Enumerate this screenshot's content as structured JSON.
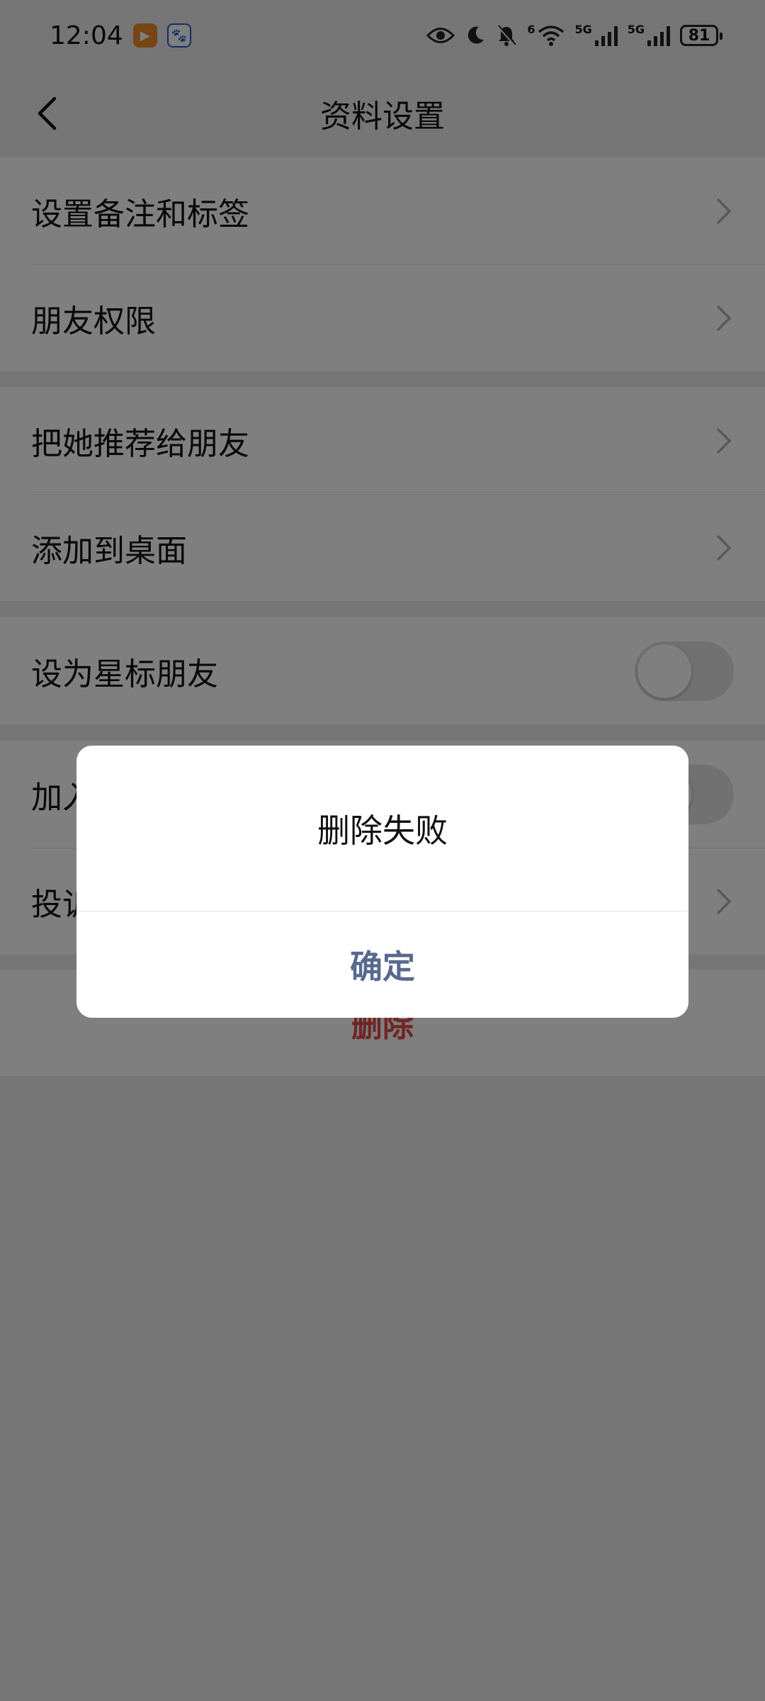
{
  "status_bar": {
    "time": "12:04",
    "net_label_1": "5G",
    "net_label_2": "5G",
    "wifi_label": "6",
    "battery": "81"
  },
  "nav": {
    "title": "资料设置"
  },
  "groups": [
    {
      "items": [
        {
          "label": "设置备注和标签"
        },
        {
          "label": "朋友权限"
        }
      ]
    },
    {
      "items": [
        {
          "label": "把她推荐给朋友"
        },
        {
          "label": "添加到桌面"
        }
      ]
    },
    {
      "items": [
        {
          "label": "设为星标朋友"
        }
      ]
    },
    {
      "items": [
        {
          "label": "加入黑名单"
        },
        {
          "label": "投诉"
        }
      ]
    }
  ],
  "delete_label": "删除",
  "dialog": {
    "message": "删除失败",
    "confirm_label": "确定"
  },
  "colors": {
    "accent": "#57698f",
    "danger": "#e04a4a"
  }
}
